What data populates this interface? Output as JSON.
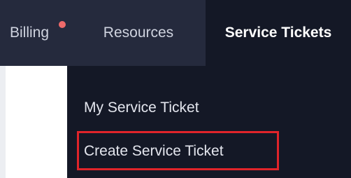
{
  "nav": {
    "billing": "Billing",
    "resources": "Resources",
    "service_tickets": "Service Tickets"
  },
  "dropdown": {
    "my_ticket": "My Service Ticket",
    "create_ticket": "Create Service Ticket"
  },
  "colors": {
    "topbar_bg": "#252a3d",
    "active_bg": "#141826",
    "notification_dot": "#ef6a6a",
    "highlight_border": "#e0242a"
  }
}
